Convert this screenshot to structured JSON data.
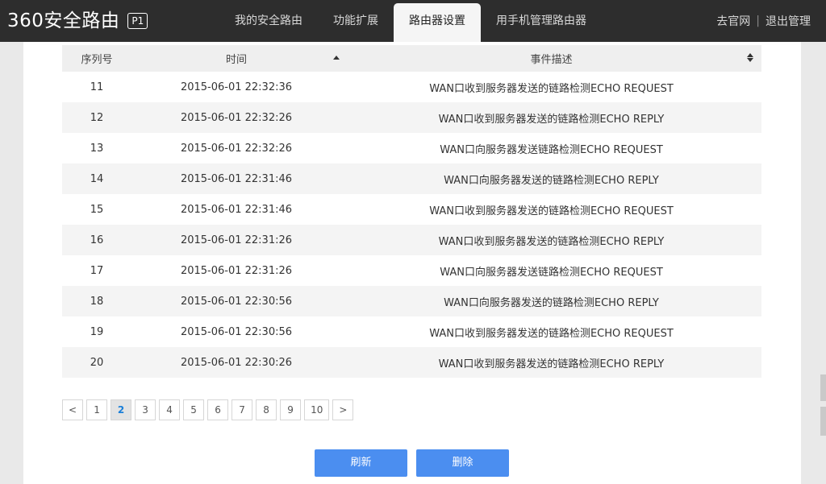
{
  "header": {
    "logo_text": "360安全路由",
    "logo_badge": "P1",
    "nav": [
      {
        "label": "我的安全路由"
      },
      {
        "label": "功能扩展"
      },
      {
        "label": "路由器设置"
      },
      {
        "label": "用手机管理路由器"
      }
    ],
    "active_nav": 2,
    "links": {
      "official": "去官网",
      "separator": "|",
      "logout": "退出管理"
    }
  },
  "table": {
    "columns": [
      "序列号",
      "时间",
      "事件描述"
    ],
    "rows": [
      {
        "id": "11",
        "time": "2015-06-01 22:32:36",
        "desc": "WAN口收到服务器发送的链路检测ECHO REQUEST"
      },
      {
        "id": "12",
        "time": "2015-06-01 22:32:26",
        "desc": "WAN口收到服务器发送的链路检测ECHO REPLY"
      },
      {
        "id": "13",
        "time": "2015-06-01 22:32:26",
        "desc": "WAN口向服务器发送链路检测ECHO REQUEST"
      },
      {
        "id": "14",
        "time": "2015-06-01 22:31:46",
        "desc": "WAN口向服务器发送的链路检测ECHO REPLY"
      },
      {
        "id": "15",
        "time": "2015-06-01 22:31:46",
        "desc": "WAN口收到服务器发送的链路检测ECHO REQUEST"
      },
      {
        "id": "16",
        "time": "2015-06-01 22:31:26",
        "desc": "WAN口收到服务器发送的链路检测ECHO REPLY"
      },
      {
        "id": "17",
        "time": "2015-06-01 22:31:26",
        "desc": "WAN口向服务器发送链路检测ECHO REQUEST"
      },
      {
        "id": "18",
        "time": "2015-06-01 22:30:56",
        "desc": "WAN口向服务器发送的链路检测ECHO REPLY"
      },
      {
        "id": "19",
        "time": "2015-06-01 22:30:56",
        "desc": "WAN口收到服务器发送的链路检测ECHO REQUEST"
      },
      {
        "id": "20",
        "time": "2015-06-01 22:30:26",
        "desc": "WAN口收到服务器发送的链路检测ECHO REPLY"
      }
    ]
  },
  "pagination": {
    "prev": "<",
    "next": ">",
    "pages": [
      "1",
      "2",
      "3",
      "4",
      "5",
      "6",
      "7",
      "8",
      "9",
      "10"
    ],
    "current": "2"
  },
  "buttons": {
    "refresh": "刷新",
    "delete": "删除"
  },
  "colors": {
    "accent": "#4b8ef0",
    "topbar": "#2d2d2d",
    "active_page": "#1a7fd8"
  }
}
